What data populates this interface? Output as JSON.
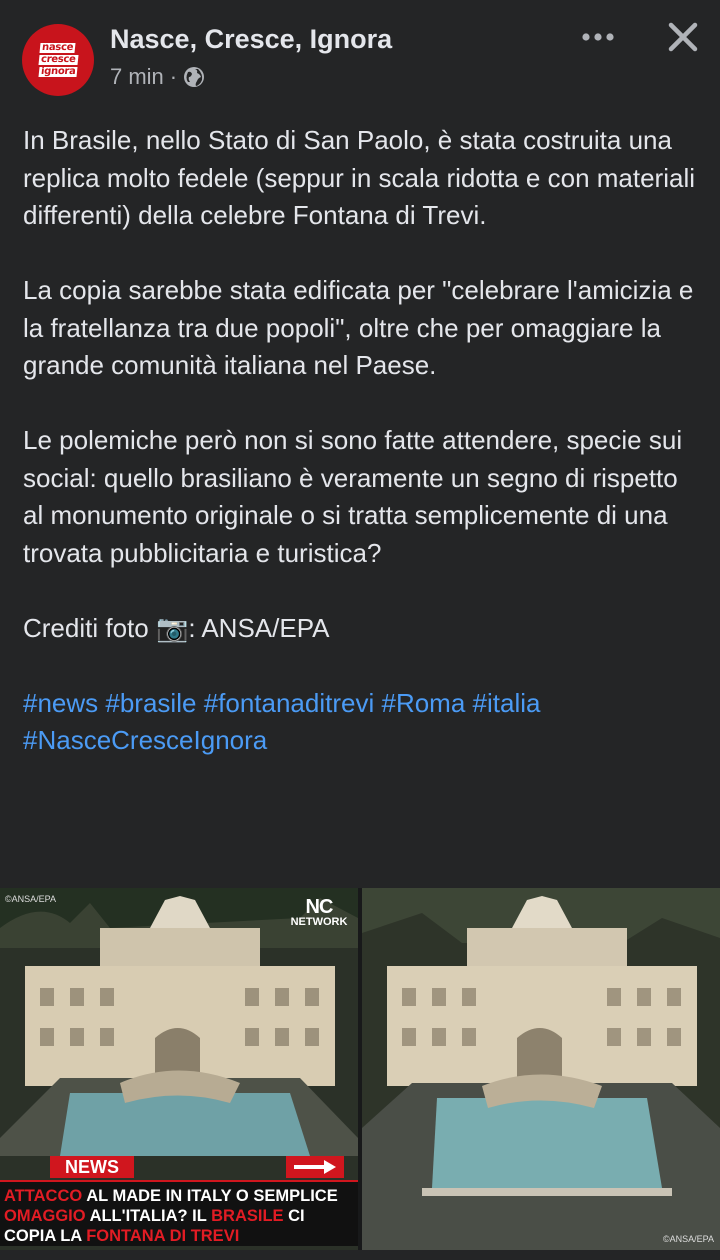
{
  "post": {
    "page_name": "Nasce, Cresce, Ignora",
    "avatar_lines": [
      "nasce",
      "cresce",
      "ignora"
    ],
    "time": "7 min",
    "separator": "·",
    "audience_icon": "globe-icon",
    "more_icon": "more-dots-icon",
    "close_icon": "close-icon"
  },
  "text": {
    "p1": "In Brasile, nello Stato di San Paolo, è stata costruita una replica molto fedele (seppur in scala ridotta e con materiali differenti) della celebre Fontana di Trevi.",
    "p2": "La copia sarebbe stata edificata per \"celebrare l'amicizia e la fratellanza tra due popoli\", oltre che per omaggiare la grande comunità italiana nel Paese.",
    "p3": "Le polemiche però non si sono fatte attendere, specie sui social: quello brasiliano è veramente un segno di rispetto al monumento originale o si tratta semplicemente di una trovata pubblicitaria e turistica?",
    "credits": "Crediti foto 📷: ANSA/EPA"
  },
  "hashtags": [
    "#news",
    "#brasile",
    "#fontanaditrevi",
    "#Roma",
    "#italia",
    "#NasceCresceIgnora"
  ],
  "photos": {
    "left": {
      "credit": "©ANSA/EPA",
      "logo_top": "NC",
      "logo_bottom": "NETWORK",
      "news_label": "NEWS",
      "headline": {
        "l1_red": "ATTACCO",
        "l1_white": " AL MADE IN ITALY O SEMPLICE",
        "l2_red": "OMAGGIO",
        "l2_white_a": " ALL'ITALIA? IL ",
        "l2_red_b": "BRASILE",
        "l2_white_b": " CI",
        "l3_white": "COPIA LA ",
        "l3_red": "FONTANA DI TREVI"
      }
    },
    "right": {
      "credit": "©ANSA/EPA"
    }
  },
  "colors": {
    "background": "#242526",
    "text": "#e4e6eb",
    "secondary": "#b0b3b8",
    "link": "#4b9bf5",
    "brand_red": "#c8141c"
  }
}
